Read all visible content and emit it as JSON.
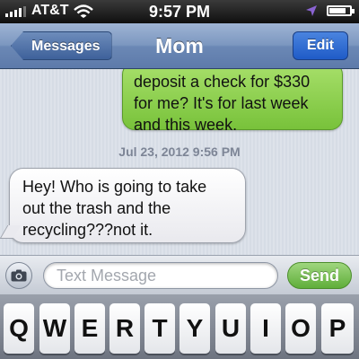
{
  "status_bar": {
    "carrier": "AT&T",
    "time": "9:57 PM",
    "icons": [
      "signal-icon",
      "wifi-icon",
      "location-icon",
      "battery-icon"
    ]
  },
  "nav": {
    "back_label": "Messages",
    "title": "Mom",
    "edit_label": "Edit"
  },
  "conversation": {
    "sent_message": "deposit a check for $330 for me? It's for last week and this week.",
    "timestamp": "Jul 23, 2012 9:56 PM",
    "received_message": "Hey! Who is going to take out the trash and the recycling???not it."
  },
  "input_bar": {
    "camera_icon": "camera-icon",
    "placeholder": "Text Message",
    "send_label": "Send"
  },
  "keyboard": {
    "row1": [
      "Q",
      "W",
      "E",
      "R",
      "T",
      "Y",
      "U",
      "I",
      "O",
      "P"
    ]
  },
  "colors": {
    "sent_bubble": "#8fd14f",
    "nav_bar": "#7c97c0",
    "send_button": "#5fae3a"
  }
}
